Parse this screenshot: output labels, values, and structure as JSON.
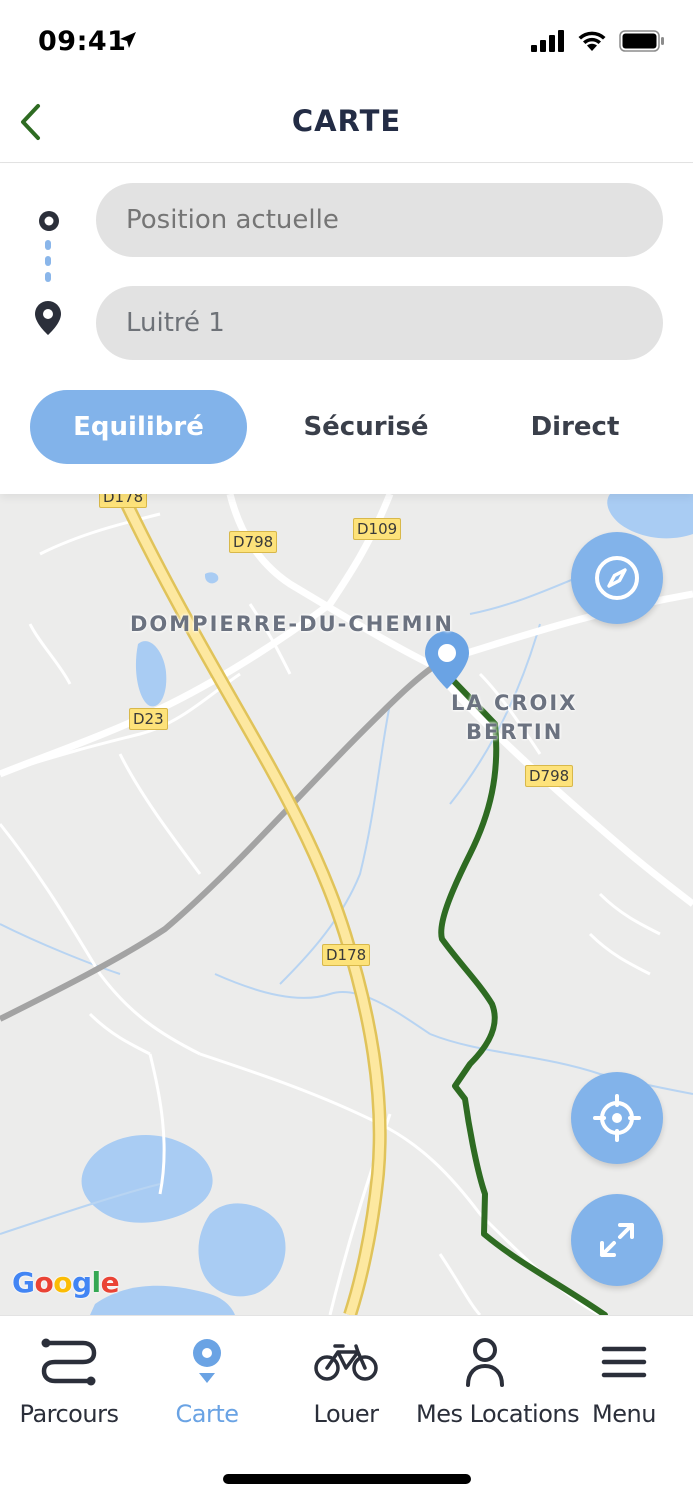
{
  "status_bar": {
    "time": "09:41"
  },
  "header": {
    "title": "CARTE"
  },
  "route": {
    "origin_placeholder": "Position actuelle",
    "destination_value": "Luitré 1"
  },
  "modes": [
    {
      "label": "Equilibré",
      "active": true
    },
    {
      "label": "Sécurisé",
      "active": false
    },
    {
      "label": "Direct",
      "active": false
    }
  ],
  "map": {
    "road_labels": [
      "D178",
      "D798",
      "D109",
      "D23",
      "D798",
      "D178"
    ],
    "places": [
      "DOMPIERRE-DU-CHEMIN",
      "LA CROIX",
      "BERTIN"
    ],
    "attribution": [
      "G",
      "o",
      "o",
      "g",
      "l",
      "e"
    ],
    "route_color": "#2e6b22",
    "accent_color": "#82b3ea"
  },
  "bottom_nav": [
    {
      "label": "Parcours",
      "icon": "route-icon",
      "active": false
    },
    {
      "label": "Carte",
      "icon": "map-pin-icon",
      "active": true
    },
    {
      "label": "Louer",
      "icon": "bicycle-icon",
      "active": false
    },
    {
      "label": "Mes Locations",
      "icon": "user-icon",
      "active": false
    },
    {
      "label": "Menu",
      "icon": "hamburger-icon",
      "active": false
    }
  ]
}
